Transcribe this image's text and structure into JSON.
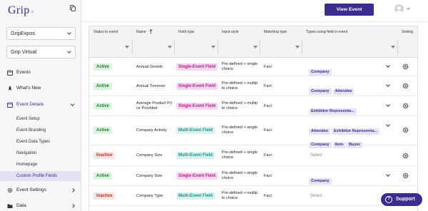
{
  "brand": {
    "logo_text": "Grip",
    "logo_sub": "ai"
  },
  "sidebar": {
    "event_selects": [
      {
        "value": "GripExpos"
      },
      {
        "value": "Grip Virtual"
      }
    ],
    "items": [
      {
        "label": "Events",
        "icon": "calendar-icon"
      },
      {
        "label": "What's New",
        "icon": "rocket-icon"
      },
      {
        "label": "Event Details",
        "icon": "calendar-icon",
        "expanded": true
      },
      {
        "label": "Event Settings",
        "icon": "gear-icon"
      },
      {
        "label": "Data",
        "icon": "folder-icon"
      }
    ],
    "subitems": [
      {
        "label": "Event Setup"
      },
      {
        "label": "Event Branding"
      },
      {
        "label": "Event Data Types"
      },
      {
        "label": "Navigation"
      },
      {
        "label": "Homepage"
      },
      {
        "label": "Custom Profile Fields",
        "selected": true
      }
    ]
  },
  "topbar": {
    "view_event_label": "View Event"
  },
  "table": {
    "headers": [
      "Status in event",
      "Name",
      "Field type",
      "Input style",
      "Matching type",
      "Types using field in event",
      "Setting"
    ],
    "select_placeholder": "Select",
    "rows": [
      {
        "status": "Active",
        "name": "Annual Growth",
        "field_type": "Single-Event Field",
        "input_style": [
          "Pre-defined + single",
          "choice"
        ],
        "matching": "Fact",
        "types": [
          "Company"
        ]
      },
      {
        "status": "Active",
        "name": "Annual Turnover",
        "field_type": "Single-Event Field",
        "input_style": [
          "Pre-defined + multip",
          "le choice"
        ],
        "matching": "Fact",
        "types": [
          "Company",
          "Attendee"
        ]
      },
      {
        "status": "Active",
        "name": [
          "Average Product Pri",
          "ce Provided"
        ],
        "field_type": "Single-Event Field",
        "input_style": [
          "Pre-defined + multip",
          "le choice"
        ],
        "matching": "Fact",
        "types": [
          "Exhibitor Representa..."
        ]
      },
      {
        "status": "Active",
        "name": "Company Activity",
        "field_type": "Multi-Event Field",
        "input_style": [
          "Pre-defined + single",
          "choice"
        ],
        "matching": "Fact",
        "types": [
          "Attendee",
          "Exhibitor Representa...",
          "Company",
          "Item",
          "Buyer"
        ]
      },
      {
        "status": "Inactive",
        "name": "Company Size",
        "field_type": "Multi-Event Field",
        "input_style": [
          "Pre-defined + single",
          "choice"
        ],
        "matching": "Fact",
        "types": []
      },
      {
        "status": "Active",
        "name": "Company Size",
        "field_type": "Single-Event Field",
        "input_style": [
          "Pre-defined + single",
          "choice"
        ],
        "matching": "Fact",
        "types": [
          "Company"
        ]
      },
      {
        "status": "Inactive",
        "name": "Company Type",
        "field_type": "Multi-Event Field",
        "input_style": [
          "Pre-defined + multip",
          "le choice"
        ],
        "matching": "Fact",
        "types": []
      }
    ]
  },
  "support": {
    "label": "Support",
    "icon_glyph": "?"
  },
  "colors": {
    "brand": "#3b2d8f",
    "active": "#1e7a2c",
    "inactive": "#c62b2b",
    "single": "#b0208a",
    "multi": "#17907f"
  }
}
